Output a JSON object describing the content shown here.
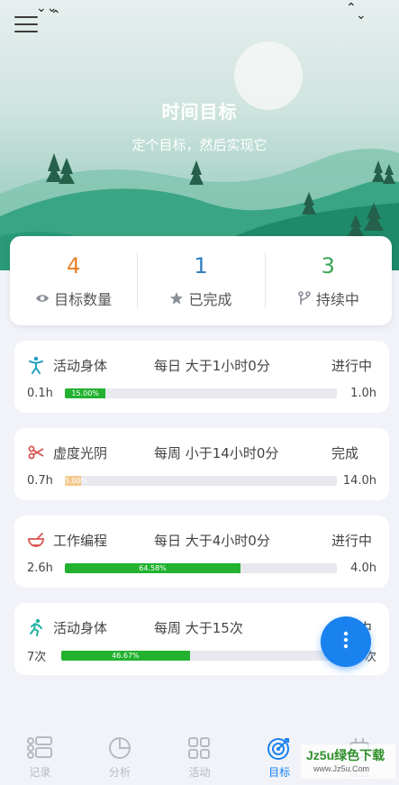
{
  "header": {
    "title": "时间目标",
    "subtitle": "定个目标，然后实现它",
    "menu_icon": "menu-icon"
  },
  "stats": [
    {
      "value": "4",
      "label": "目标数量",
      "icon": "eye-icon",
      "color": "#e8822a"
    },
    {
      "value": "1",
      "label": "已完成",
      "icon": "star-icon",
      "color": "#2f7fc1"
    },
    {
      "value": "3",
      "label": "持续中",
      "icon": "fork-icon",
      "color": "#3aa657"
    }
  ],
  "goals": [
    {
      "icon": "stretch-person-icon",
      "icon_color": "#1fa0c4",
      "name": "活动身体",
      "rule": "每日 大于1小时0分",
      "status": "进行中",
      "min": "0.1h",
      "max": "1.0h",
      "progress_label": "15.00%",
      "progress": 0.15,
      "bar_color": "#22b22f"
    },
    {
      "icon": "scissors-icon",
      "icon_color": "#d9534f",
      "name": "虚度光阴",
      "rule": "每周 小于14小时0分",
      "status": "完成",
      "min": "0.7h",
      "max": "14.0h",
      "progress_label": "5.00%",
      "progress": 0.05,
      "bar_color": "#f3c98e"
    },
    {
      "icon": "bowl-icon",
      "icon_color": "#d9534f",
      "name": "工作编程",
      "rule": "每日 大于4小时0分",
      "status": "进行中",
      "min": "2.6h",
      "max": "4.0h",
      "progress_label": "64.58%",
      "progress": 0.6458,
      "bar_color": "#22b22f"
    },
    {
      "icon": "running-icon",
      "icon_color": "#1fb3a0",
      "name": "活动身体",
      "rule": "每周 大于15次",
      "status": "进行中",
      "min": "7次",
      "max": "15次",
      "progress_label": "46.67%",
      "progress": 0.4667,
      "bar_color": "#22b22f"
    }
  ],
  "fab": {
    "icon": "more-vertical-icon",
    "color": "#1a82ef"
  },
  "nav": [
    {
      "label": "记录",
      "icon": "record-icon",
      "active": false
    },
    {
      "label": "分析",
      "icon": "pie-chart-icon",
      "active": false
    },
    {
      "label": "活动",
      "icon": "grid-icon",
      "active": false
    },
    {
      "label": "目标",
      "icon": "target-icon",
      "active": true
    },
    {
      "label": "设置",
      "icon": "settings-icon",
      "active": false
    }
  ],
  "watermark": {
    "main": "Jz5u绿色下载",
    "sub": "www.Jz5u.Com"
  }
}
